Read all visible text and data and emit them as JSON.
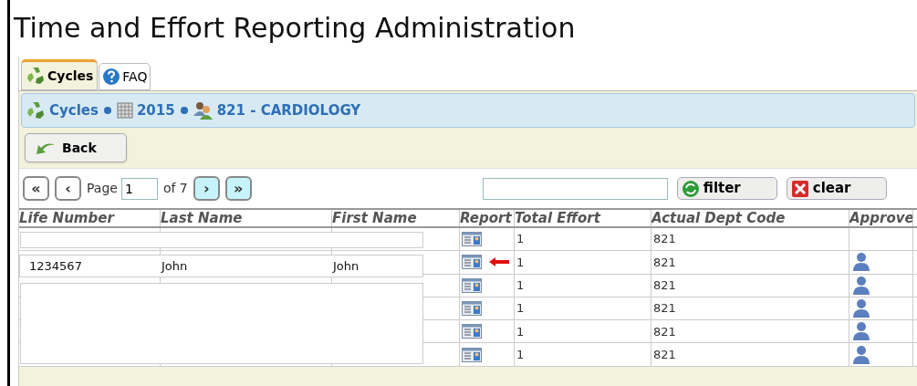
{
  "title": "Time and Effort Reporting Administration",
  "tabs": [
    {
      "label": "Cycles",
      "selected": true
    },
    {
      "label": "FAQ",
      "selected": false
    }
  ],
  "breadcrumb": [
    {
      "label": "Cycles"
    },
    {
      "label": "2015"
    },
    {
      "label": "821 - CARDIOLOGY"
    }
  ],
  "back_button": "Back",
  "pager": {
    "first": "«",
    "prev": "‹",
    "page_label": "Page",
    "page": "1",
    "of_label": "of 7",
    "next": "›",
    "last": "»"
  },
  "filter_button": "filter",
  "clear_button": "clear",
  "table": {
    "columns": [
      "Life Number",
      "Last Name",
      "First Name",
      "Report",
      "Total Effort",
      "Actual Dept Code",
      "Approve"
    ],
    "rows": [
      {
        "total_effort": "1",
        "dept_code": "821",
        "approver": false,
        "marked": false
      },
      {
        "life_number": "1234567",
        "last_name": "John",
        "first_name": "John",
        "total_effort": "1",
        "dept_code": "821",
        "approver": true,
        "marked": true
      },
      {
        "total_effort": "1",
        "dept_code": "821",
        "approver": true,
        "marked": false
      },
      {
        "total_effort": "1",
        "dept_code": "821",
        "approver": true,
        "marked": false
      },
      {
        "total_effort": "1",
        "dept_code": "821",
        "approver": true,
        "marked": false
      },
      {
        "total_effort": "1",
        "dept_code": "821",
        "approver": true,
        "marked": false
      }
    ]
  }
}
